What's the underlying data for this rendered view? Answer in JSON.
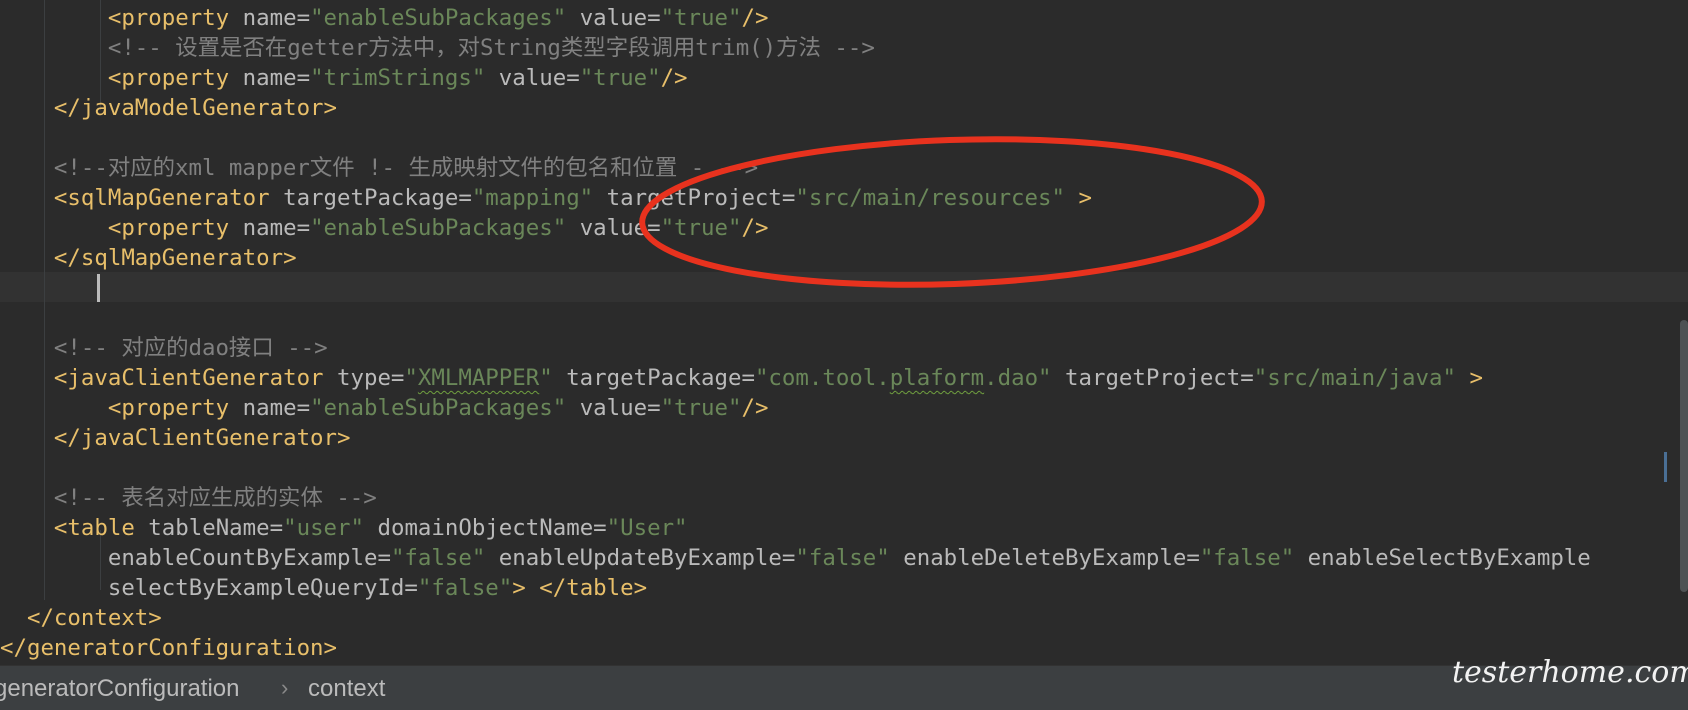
{
  "editor": {
    "lines": [
      [
        {
          "t": "        "
        },
        {
          "k": "tag",
          "t": "<property "
        },
        {
          "k": "attr",
          "t": "name="
        },
        {
          "k": "val",
          "t": "\"enableSubPackages\""
        },
        {
          "t": " "
        },
        {
          "k": "attr",
          "t": "value="
        },
        {
          "k": "val",
          "t": "\"true\""
        },
        {
          "k": "tag",
          "t": "/>"
        }
      ],
      [
        {
          "t": "        "
        },
        {
          "k": "cmt",
          "t": "<!-- 设置是否在getter方法中，对String类型字段调用trim()方法 -->"
        }
      ],
      [
        {
          "t": "        "
        },
        {
          "k": "tag",
          "t": "<property "
        },
        {
          "k": "attr",
          "t": "name="
        },
        {
          "k": "val",
          "t": "\"trimStrings\""
        },
        {
          "t": " "
        },
        {
          "k": "attr",
          "t": "value="
        },
        {
          "k": "val",
          "t": "\"true\""
        },
        {
          "k": "tag",
          "t": "/>"
        }
      ],
      [
        {
          "t": "    "
        },
        {
          "k": "tag",
          "t": "</javaModelGenerator>"
        }
      ],
      [],
      [
        {
          "t": "    "
        },
        {
          "k": "cmt",
          "t": "<!--对应的xml mapper文件 !- 生成映射文件的包名和位置 - -->"
        }
      ],
      [
        {
          "t": "    "
        },
        {
          "k": "tag",
          "t": "<sqlMapGenerator "
        },
        {
          "k": "attr",
          "t": "targetPackage="
        },
        {
          "k": "val",
          "t": "\"mapping\""
        },
        {
          "t": " "
        },
        {
          "k": "attr",
          "t": "targetProject="
        },
        {
          "k": "val",
          "t": "\"src/main/resources\""
        },
        {
          "t": " "
        },
        {
          "k": "tag",
          "t": ">"
        }
      ],
      [
        {
          "t": "        "
        },
        {
          "k": "tag",
          "t": "<property "
        },
        {
          "k": "attr",
          "t": "name="
        },
        {
          "k": "val",
          "t": "\"enableSubPackages\""
        },
        {
          "t": " "
        },
        {
          "k": "attr",
          "t": "value="
        },
        {
          "k": "val",
          "t": "\"true\""
        },
        {
          "k": "tag",
          "t": "/>"
        }
      ],
      [
        {
          "t": "    "
        },
        {
          "k": "tag",
          "t": "</sqlMapGenerator>"
        }
      ],
      [],
      [],
      [
        {
          "t": "    "
        },
        {
          "k": "cmt",
          "t": "<!-- 对应的dao接口 -->"
        }
      ],
      [
        {
          "t": "    "
        },
        {
          "k": "tag",
          "t": "<javaClientGenerator "
        },
        {
          "k": "attr",
          "t": "type="
        },
        {
          "k": "val",
          "t": "\""
        },
        {
          "k": "val",
          "t": "XMLMAPPER",
          "sq": true
        },
        {
          "k": "val",
          "t": "\""
        },
        {
          "t": " "
        },
        {
          "k": "attr",
          "t": "targetPackage="
        },
        {
          "k": "val",
          "t": "\"com.tool."
        },
        {
          "k": "val",
          "t": "plaform",
          "sq": true
        },
        {
          "k": "val",
          "t": ".dao\""
        },
        {
          "t": " "
        },
        {
          "k": "attr",
          "t": "targetProject="
        },
        {
          "k": "val",
          "t": "\"src/main/java\""
        },
        {
          "t": " "
        },
        {
          "k": "tag",
          "t": ">"
        }
      ],
      [
        {
          "t": "        "
        },
        {
          "k": "tag",
          "t": "<property "
        },
        {
          "k": "attr",
          "t": "name="
        },
        {
          "k": "val",
          "t": "\"enableSubPackages\""
        },
        {
          "t": " "
        },
        {
          "k": "attr",
          "t": "value="
        },
        {
          "k": "val",
          "t": "\"true\""
        },
        {
          "k": "tag",
          "t": "/>"
        }
      ],
      [
        {
          "t": "    "
        },
        {
          "k": "tag",
          "t": "</javaClientGenerator>"
        }
      ],
      [],
      [
        {
          "t": "    "
        },
        {
          "k": "cmt",
          "t": "<!-- 表名对应生成的实体 -->"
        }
      ],
      [
        {
          "t": "    "
        },
        {
          "k": "tag",
          "t": "<table "
        },
        {
          "k": "attr",
          "t": "tableName="
        },
        {
          "k": "val",
          "t": "\"user\""
        },
        {
          "t": " "
        },
        {
          "k": "attr",
          "t": "domainObjectName="
        },
        {
          "k": "val",
          "t": "\"User\""
        }
      ],
      [
        {
          "t": "        "
        },
        {
          "k": "attr",
          "t": "enableCountByExample="
        },
        {
          "k": "val",
          "t": "\"false\""
        },
        {
          "t": " "
        },
        {
          "k": "attr",
          "t": "enableUpdateByExample="
        },
        {
          "k": "val",
          "t": "\"false\""
        },
        {
          "t": " "
        },
        {
          "k": "attr",
          "t": "enableDeleteByExample="
        },
        {
          "k": "val",
          "t": "\"false\""
        },
        {
          "t": " "
        },
        {
          "k": "attr",
          "t": "enableSelectByExample"
        }
      ],
      [
        {
          "t": "        "
        },
        {
          "k": "attr",
          "t": "selectByExampleQueryId="
        },
        {
          "k": "val",
          "t": "\"false\""
        },
        {
          "k": "tag",
          "t": ">"
        },
        {
          "t": " "
        },
        {
          "k": "tag",
          "t": "</table>"
        }
      ],
      [
        {
          "t": "  "
        },
        {
          "k": "tag",
          "t": "</context>"
        }
      ],
      [
        {
          "k": "tag",
          "t": "</generatorConfiguration>"
        }
      ]
    ]
  },
  "breadcrumb": {
    "items": [
      "generatorConfiguration",
      "context"
    ],
    "separator": "›"
  },
  "watermark": "testerhome.com",
  "colors": {
    "background": "#2b2b2b",
    "tag": "#e8bf6a",
    "attribute": "#bababa",
    "value": "#6a8759",
    "comment": "#808080",
    "annotation": "#e8321e"
  }
}
